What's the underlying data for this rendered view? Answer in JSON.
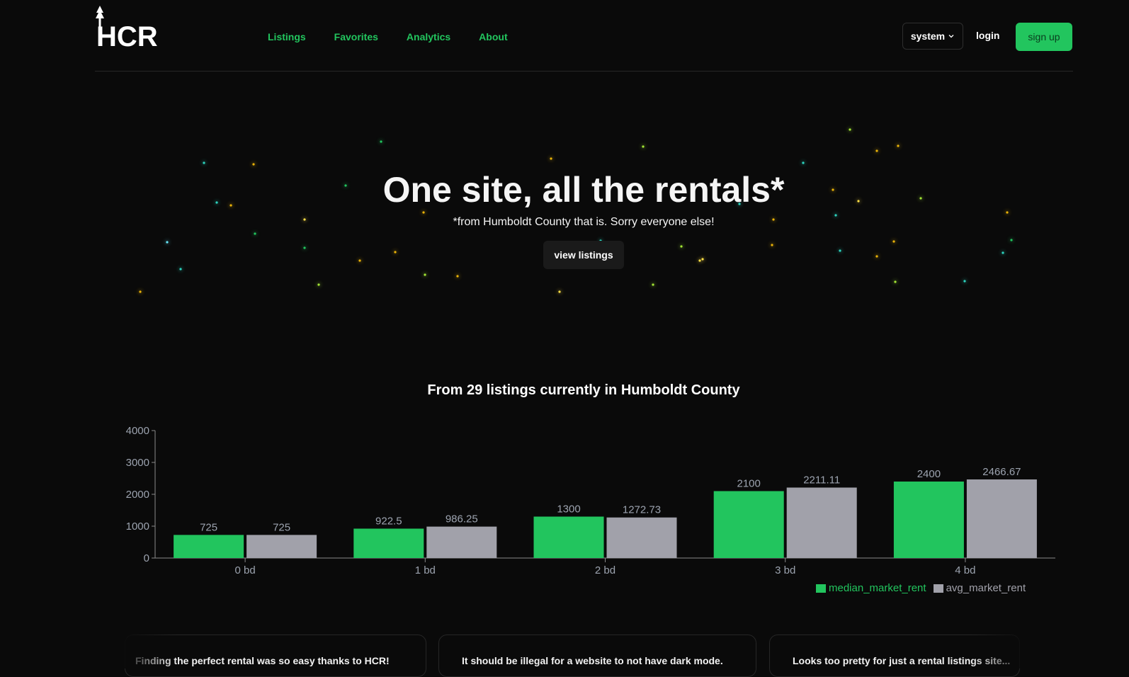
{
  "brand": {
    "logo_text": "HCR",
    "accent": "#22c55e"
  },
  "nav": [
    {
      "label": "Listings"
    },
    {
      "label": "Favorites"
    },
    {
      "label": "Analytics"
    },
    {
      "label": "About"
    }
  ],
  "header": {
    "theme_select": "system",
    "login_label": "login",
    "signup_label": "sign up"
  },
  "hero": {
    "title": "One site, all the rentals*",
    "subtitle": "*from Humboldt County that is. Sorry everyone else!",
    "cta_label": "view listings"
  },
  "chart_section": {
    "title": "From 29 listings currently in Humboldt County"
  },
  "chart_data": {
    "type": "bar",
    "categories": [
      "0 bd",
      "1 bd",
      "2 bd",
      "3 bd",
      "4 bd"
    ],
    "series": [
      {
        "name": "median_market_rent",
        "values": [
          725,
          922.5,
          1300,
          2100,
          2400
        ],
        "labels": [
          "725",
          "922.5",
          "1300",
          "2100",
          "2400"
        ],
        "color": "#22c55e"
      },
      {
        "name": "avg_market_rent",
        "values": [
          725,
          986.25,
          1272.73,
          2211.11,
          2466.67
        ],
        "labels": [
          "725",
          "986.25",
          "1272.73",
          "2211.11",
          "2466.67"
        ],
        "color": "#a1a1aa"
      }
    ],
    "yticks": [
      0,
      1000,
      2000,
      3000,
      4000
    ],
    "ylim": [
      0,
      4000
    ],
    "grid": false,
    "legend_position": "bottom-right",
    "title": "",
    "xlabel": "",
    "ylabel": ""
  },
  "testimonials": [
    {
      "text": "Finding the perfect rental was so easy thanks to HCR!"
    },
    {
      "text": "It should be illegal for a website to not have dark mode."
    },
    {
      "text": "Looks too pretty for just a rental listings site..."
    }
  ]
}
